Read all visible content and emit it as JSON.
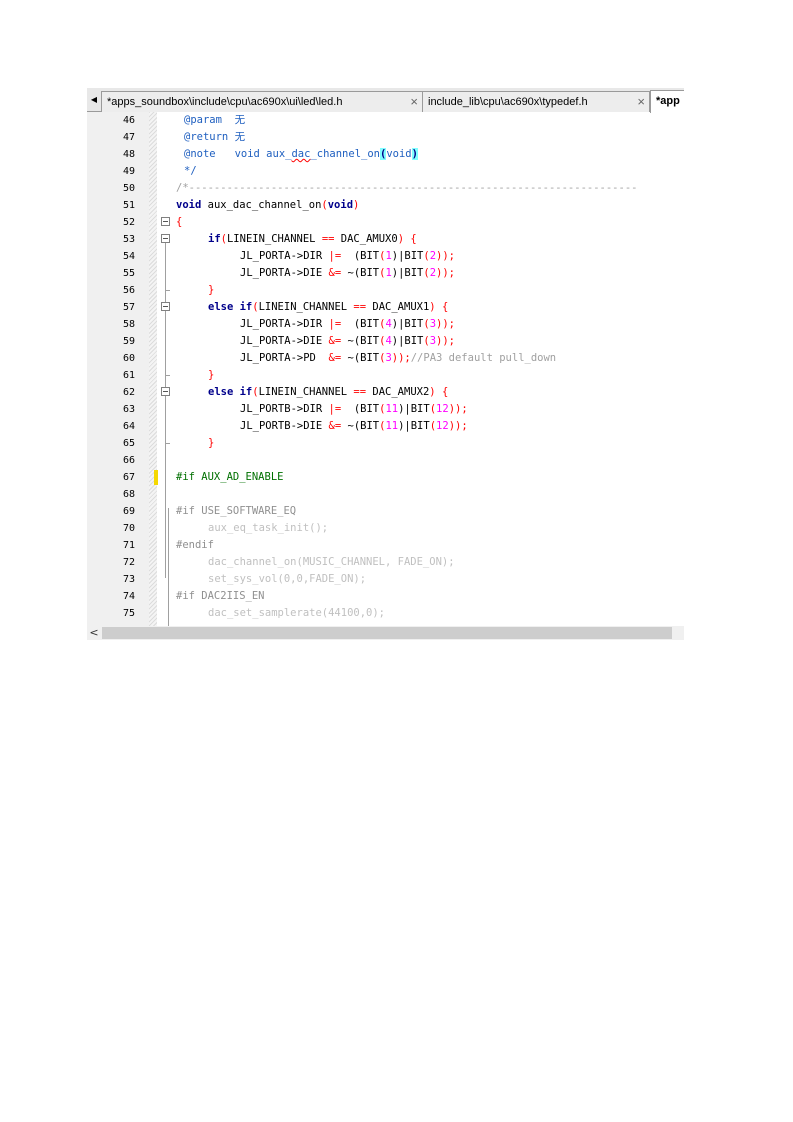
{
  "tabs": [
    {
      "label": "*apps_soundbox\\include\\cpu\\ac690x\\ui\\led\\led.h",
      "close": "×"
    },
    {
      "label": "include_lib\\cpu\\ac690x\\typedef.h",
      "close": "×"
    },
    {
      "label": "*app",
      "close": ""
    }
  ],
  "icons": {
    "tab_scroll_left": "◀",
    "hscroll_left": "<"
  },
  "line_numbers": [
    "46",
    "47",
    "48",
    "49",
    "50",
    "51",
    "52",
    "53",
    "54",
    "55",
    "56",
    "57",
    "58",
    "59",
    "60",
    "61",
    "62",
    "63",
    "64",
    "65",
    "66",
    "67",
    "68",
    "69",
    "70",
    "71",
    "72",
    "73",
    "74",
    "75"
  ],
  "code": {
    "l46_tag": "@param",
    "l46_val": "无",
    "l47_tag": "@return",
    "l47_val": "无",
    "l48_tag": "@note",
    "l48_fn_a": "void aux_",
    "l48_fn_b": "dac",
    "l48_fn_c": "_channel_on",
    "l48_po": "(",
    "l48_arg": "void",
    "l48_pc": ")",
    "l49": "*/",
    "l50": "/*-----------------------------------------------------------------------",
    "l51_kw": "void",
    "l51_name": " aux_dac_channel_on",
    "l51_po": "(",
    "l51_arg": "void",
    "l51_pc": ")",
    "l52": "{",
    "l53_kw": "if",
    "l53_po": "(",
    "l53_a": "LINEIN_CHANNEL ",
    "l53_op": "==",
    "l53_b": " DAC_AMUX0",
    "l53_pc": ") {",
    "l54_a": "JL_PORTA->DIR ",
    "l54_op": "|=",
    "l54_b": "  (BIT",
    "l54_c": "(",
    "l54_n1": "1",
    "l54_d": ")|BIT",
    "l54_e": "(",
    "l54_n2": "2",
    "l54_f": "));",
    "l55_a": "JL_PORTA->DIE ",
    "l55_op": "&=",
    "l55_b": " ~(BIT",
    "l55_c": "(",
    "l55_n1": "1",
    "l55_d": ")|BIT",
    "l55_e": "(",
    "l55_n2": "2",
    "l55_f": "));",
    "l56": "}",
    "l57_kw": "else if",
    "l57_po": "(",
    "l57_a": "LINEIN_CHANNEL ",
    "l57_op": "==",
    "l57_b": " DAC_AMUX1",
    "l57_pc": ") {",
    "l58_a": "JL_PORTA->DIR ",
    "l58_op": "|=",
    "l58_b": "  (BIT",
    "l58_c": "(",
    "l58_n1": "4",
    "l58_d": ")|BIT",
    "l58_e": "(",
    "l58_n2": "3",
    "l58_f": "));",
    "l59_a": "JL_PORTA->DIE ",
    "l59_op": "&=",
    "l59_b": " ~(BIT",
    "l59_c": "(",
    "l59_n1": "4",
    "l59_d": ")|BIT",
    "l59_e": "(",
    "l59_n2": "3",
    "l59_f": "));",
    "l60_a": "JL_PORTA->PD  ",
    "l60_op": "&=",
    "l60_b": " ~(BIT",
    "l60_c": "(",
    "l60_n1": "3",
    "l60_f": "));",
    "l60_cmt": "//PA3 default pull_down",
    "l61": "}",
    "l62_kw": "else if",
    "l62_po": "(",
    "l62_a": "LINEIN_CHANNEL ",
    "l62_op": "==",
    "l62_b": " DAC_AMUX2",
    "l62_pc": ") {",
    "l63_a": "JL_PORTB->DIR ",
    "l63_op": "|=",
    "l63_b": "  (BIT",
    "l63_c": "(",
    "l63_n1": "11",
    "l63_d": ")|BIT",
    "l63_e": "(",
    "l63_n2": "12",
    "l63_f": "));",
    "l64_a": "JL_PORTB->DIE ",
    "l64_op": "&=",
    "l64_b": " ~(BIT",
    "l64_c": "(",
    "l64_n1": "11",
    "l64_d": ")|BIT",
    "l64_e": "(",
    "l64_n2": "12",
    "l64_f": "));",
    "l65": "}",
    "l67": "#if AUX_AD_ENABLE",
    "l69": "#if USE_SOFTWARE_EQ",
    "l70": "aux_eq_task_init();",
    "l71": "#endif",
    "l72": "dac_channel_on(MUSIC_CHANNEL, FADE_ON);",
    "l73": "set_sys_vol(0,0,FADE_ON);",
    "l74": "#if DAC2IIS_EN",
    "l75": "dac_set_samplerate(44100,0);"
  },
  "colors": {
    "keyword": "#00008b",
    "doc_comment": "#2060c0",
    "comment": "#a0a0a0",
    "preprocessor": "#007000",
    "number": "#ff00ff",
    "operator": "#ff0000",
    "inactive": "#c0c0c0",
    "brace_highlight": "#80ffff",
    "change_marker": "#f5d800"
  }
}
